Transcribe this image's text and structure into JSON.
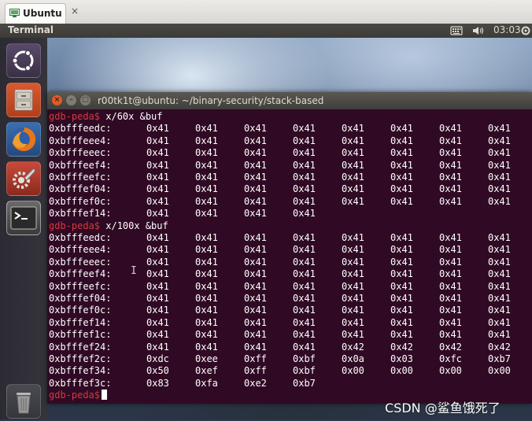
{
  "host": {
    "tab_label": "Ubuntu",
    "close_glyph": "×",
    "tab_icon": "vm-icon"
  },
  "top_panel": {
    "app_name": "Terminal",
    "clock": "03:03",
    "icons": [
      "keyboard-icon",
      "volume-icon",
      "power-gear-icon"
    ]
  },
  "launcher": {
    "items": [
      "ubuntu-dash-icon",
      "files-icon",
      "firefox-icon",
      "system-settings-icon",
      "terminal-icon",
      "trash-icon"
    ]
  },
  "terminal": {
    "title": "r00tk1t@ubuntu: ~/binary-security/stack-based",
    "prompt": "gdb-peda$",
    "commands": [
      {
        "command": "x/60x &buf",
        "rows": [
          {
            "addr": "0xbfffeedc:",
            "values": [
              "0x41",
              "0x41",
              "0x41",
              "0x41",
              "0x41",
              "0x41",
              "0x41",
              "0x41"
            ]
          },
          {
            "addr": "0xbfffeee4:",
            "values": [
              "0x41",
              "0x41",
              "0x41",
              "0x41",
              "0x41",
              "0x41",
              "0x41",
              "0x41"
            ]
          },
          {
            "addr": "0xbfffeeec:",
            "values": [
              "0x41",
              "0x41",
              "0x41",
              "0x41",
              "0x41",
              "0x41",
              "0x41",
              "0x41"
            ]
          },
          {
            "addr": "0xbfffeef4:",
            "values": [
              "0x41",
              "0x41",
              "0x41",
              "0x41",
              "0x41",
              "0x41",
              "0x41",
              "0x41"
            ]
          },
          {
            "addr": "0xbfffeefc:",
            "values": [
              "0x41",
              "0x41",
              "0x41",
              "0x41",
              "0x41",
              "0x41",
              "0x41",
              "0x41"
            ]
          },
          {
            "addr": "0xbfffef04:",
            "values": [
              "0x41",
              "0x41",
              "0x41",
              "0x41",
              "0x41",
              "0x41",
              "0x41",
              "0x41"
            ]
          },
          {
            "addr": "0xbfffef0c:",
            "values": [
              "0x41",
              "0x41",
              "0x41",
              "0x41",
              "0x41",
              "0x41",
              "0x41",
              "0x41"
            ]
          },
          {
            "addr": "0xbfffef14:",
            "values": [
              "0x41",
              "0x41",
              "0x41",
              "0x41"
            ]
          }
        ]
      },
      {
        "command": "x/100x &buf",
        "rows": [
          {
            "addr": "0xbfffeedc:",
            "values": [
              "0x41",
              "0x41",
              "0x41",
              "0x41",
              "0x41",
              "0x41",
              "0x41",
              "0x41"
            ]
          },
          {
            "addr": "0xbfffeee4:",
            "values": [
              "0x41",
              "0x41",
              "0x41",
              "0x41",
              "0x41",
              "0x41",
              "0x41",
              "0x41"
            ]
          },
          {
            "addr": "0xbfffeeec:",
            "values": [
              "0x41",
              "0x41",
              "0x41",
              "0x41",
              "0x41",
              "0x41",
              "0x41",
              "0x41"
            ]
          },
          {
            "addr": "0xbfffeef4:",
            "values": [
              "0x41",
              "0x41",
              "0x41",
              "0x41",
              "0x41",
              "0x41",
              "0x41",
              "0x41"
            ]
          },
          {
            "addr": "0xbfffeefc:",
            "values": [
              "0x41",
              "0x41",
              "0x41",
              "0x41",
              "0x41",
              "0x41",
              "0x41",
              "0x41"
            ]
          },
          {
            "addr": "0xbfffef04:",
            "values": [
              "0x41",
              "0x41",
              "0x41",
              "0x41",
              "0x41",
              "0x41",
              "0x41",
              "0x41"
            ]
          },
          {
            "addr": "0xbfffef0c:",
            "values": [
              "0x41",
              "0x41",
              "0x41",
              "0x41",
              "0x41",
              "0x41",
              "0x41",
              "0x41"
            ]
          },
          {
            "addr": "0xbfffef14:",
            "values": [
              "0x41",
              "0x41",
              "0x41",
              "0x41",
              "0x41",
              "0x41",
              "0x41",
              "0x41"
            ]
          },
          {
            "addr": "0xbfffef1c:",
            "values": [
              "0x41",
              "0x41",
              "0x41",
              "0x41",
              "0x41",
              "0x41",
              "0x41",
              "0x41"
            ]
          },
          {
            "addr": "0xbfffef24:",
            "values": [
              "0x41",
              "0x41",
              "0x41",
              "0x41",
              "0x42",
              "0x42",
              "0x42",
              "0x42"
            ]
          },
          {
            "addr": "0xbfffef2c:",
            "values": [
              "0xdc",
              "0xee",
              "0xff",
              "0xbf",
              "0x0a",
              "0x03",
              "0xfc",
              "0xb7"
            ]
          },
          {
            "addr": "0xbfffef34:",
            "values": [
              "0x50",
              "0xef",
              "0xff",
              "0xbf",
              "0x00",
              "0x00",
              "0x00",
              "0x00"
            ]
          },
          {
            "addr": "0xbfffef3c:",
            "values": [
              "0x83",
              "0xfa",
              "0xe2",
              "0xb7"
            ]
          }
        ]
      }
    ]
  },
  "watermark": "CSDN @鲨鱼饿死了",
  "colors": {
    "terminal_bg": "#300a24",
    "prompt": "#d23b3b",
    "close_button": "#e05a2b",
    "other_button": "#7d7b74"
  }
}
